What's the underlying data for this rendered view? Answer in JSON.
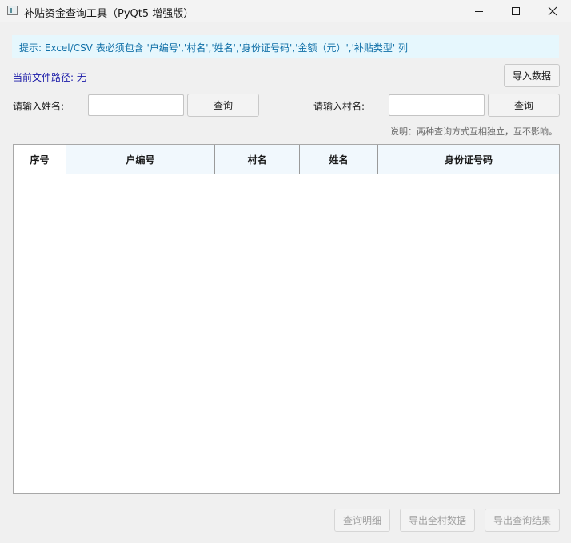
{
  "window": {
    "title": "补贴资金查询工具（PyQt5 增强版）",
    "controls": [
      "minimize-icon",
      "maximize-icon",
      "close-icon"
    ]
  },
  "hint": "提示: Excel/CSV 表必须包含 '户编号','村名','姓名','身份证号码','金额（元）','补贴类型' 列",
  "file": {
    "label": "当前文件路径:",
    "value": "无",
    "import_button": "导入数据"
  },
  "search_name": {
    "label": "请输入姓名:",
    "value": "",
    "button": "查询"
  },
  "search_village": {
    "label": "请输入村名:",
    "value": "",
    "button": "查询"
  },
  "note": "说明：两种查询方式互相独立，互不影响。",
  "table": {
    "columns": [
      "序号",
      "户编号",
      "村名",
      "姓名",
      "身份证号码"
    ],
    "rows": []
  },
  "footer": {
    "detail_button": "查询明细",
    "export_village_button": "导出全村数据",
    "export_result_button": "导出查询结果"
  },
  "colors": {
    "hint_background": "#e6f7fd",
    "hint_text": "#1170a8",
    "path_text": "#1a1aa8",
    "header_background": "#f1f8fd"
  }
}
